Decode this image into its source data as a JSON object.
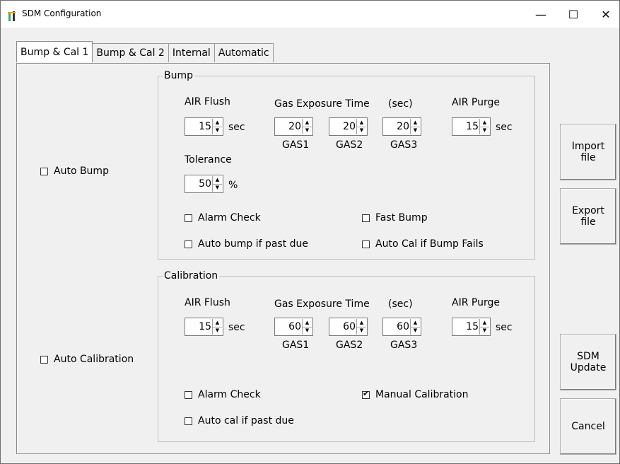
{
  "window": {
    "title": "SDM Configuration",
    "minimize": "—",
    "maximize": "☐",
    "close": "✕"
  },
  "tabs": [
    "Bump & Cal 1",
    "Bump & Cal 2",
    "Internal",
    "Automatic"
  ],
  "auto_bump_label": "Auto Bump",
  "auto_calibration_label": "Auto Calibration",
  "bump": {
    "title": "Bump",
    "air_flush_label": "AIR Flush",
    "air_flush_value": "15",
    "sec_unit": "sec",
    "gas_exposure_label": "Gas Exposure Time",
    "sec_paren": "(sec)",
    "gas1_value": "20",
    "gas2_value": "20",
    "gas3_value": "20",
    "gas1_label": "GAS1",
    "gas2_label": "GAS2",
    "gas3_label": "GAS3",
    "air_purge_label": "AIR Purge",
    "air_purge_value": "15",
    "tolerance_label": "Tolerance",
    "tolerance_value": "50",
    "percent_unit": "%",
    "alarm_check": "Alarm Check",
    "fast_bump": "Fast Bump",
    "auto_bump_past_due": "Auto bump if past due",
    "auto_cal_bump_fails": "Auto Cal if Bump Fails"
  },
  "calibration": {
    "title": "Calibration",
    "air_flush_label": "AIR Flush",
    "air_flush_value": "15",
    "sec_unit": "sec",
    "gas_exposure_label": "Gas Exposure Time",
    "sec_paren": "(sec)",
    "gas1_value": "60",
    "gas2_value": "60",
    "gas3_value": "60",
    "gas1_label": "GAS1",
    "gas2_label": "GAS2",
    "gas3_label": "GAS3",
    "air_purge_label": "AIR Purge",
    "air_purge_value": "15",
    "alarm_check": "Alarm Check",
    "manual_calibration": "Manual Calibration",
    "auto_cal_past_due": "Auto cal if past due"
  },
  "buttons": {
    "import_line1": "Import",
    "import_line2": "file",
    "export_line1": "Export",
    "export_line2": "file",
    "sdm_line1": "SDM",
    "sdm_line2": "Update",
    "cancel": "Cancel"
  }
}
